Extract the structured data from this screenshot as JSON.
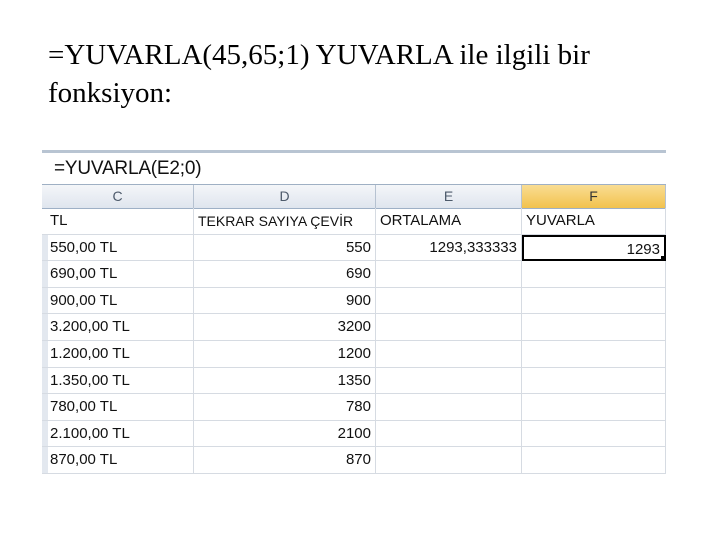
{
  "caption": {
    "line1": "=YUVARLA(45,65;1) YUVARLA ile ilgili bir",
    "line2": "fonksiyon:"
  },
  "formula_bar": {
    "text": "=YUVARLA(E2;0)"
  },
  "columns": [
    {
      "letter": "C",
      "active": false
    },
    {
      "letter": "D",
      "active": false
    },
    {
      "letter": "E",
      "active": false
    },
    {
      "letter": "F",
      "active": true
    }
  ],
  "header_row": [
    "TL",
    "TEKRAR SAYIYA ÇEVİR",
    "ORTALAMA",
    "YUVARLA"
  ],
  "rows": [
    {
      "c": "550,00 TL",
      "d": "550",
      "e": "1293,333333",
      "f": "1293"
    },
    {
      "c": "690,00 TL",
      "d": "690",
      "e": "",
      "f": ""
    },
    {
      "c": "900,00 TL",
      "d": "900",
      "e": "",
      "f": ""
    },
    {
      "c": "3.200,00 TL",
      "d": "3200",
      "e": "",
      "f": ""
    },
    {
      "c": "1.200,00 TL",
      "d": "1200",
      "e": "",
      "f": ""
    },
    {
      "c": "1.350,00 TL",
      "d": "1350",
      "e": "",
      "f": ""
    },
    {
      "c": "780,00 TL",
      "d": "780",
      "e": "",
      "f": ""
    },
    {
      "c": "2.100,00 TL",
      "d": "2100",
      "e": "",
      "f": ""
    },
    {
      "c": "870,00 TL",
      "d": "870",
      "e": "",
      "f": ""
    }
  ],
  "selected_cell": "F2",
  "colors": {
    "active_header": "#f2c24d",
    "grid_line": "#d6dbe2",
    "header_bg": "#dfe5ee"
  }
}
